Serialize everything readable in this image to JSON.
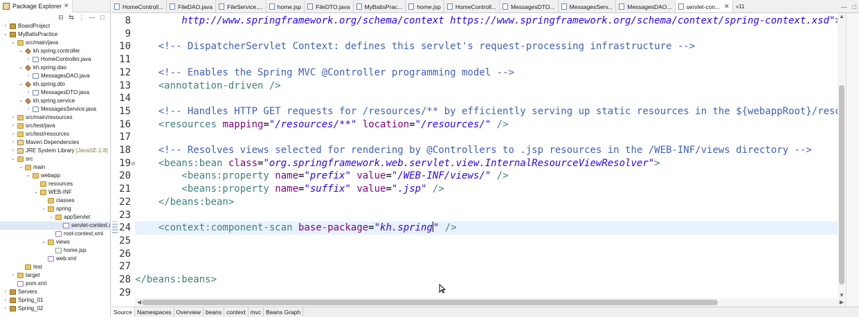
{
  "package_explorer": {
    "title": "Package Explorer",
    "tree": [
      {
        "label": "BoardProject",
        "depth": 0,
        "twisty": ">",
        "icon": "project"
      },
      {
        "label": "MyBatisPractice",
        "depth": 0,
        "twisty": "v",
        "icon": "project"
      },
      {
        "label": "src/main/java",
        "depth": 1,
        "twisty": "v",
        "icon": "folder"
      },
      {
        "label": "kh.spring.controller",
        "depth": 2,
        "twisty": "v",
        "icon": "pkg"
      },
      {
        "label": "HomeController.java",
        "depth": 3,
        "twisty": ">",
        "icon": "java"
      },
      {
        "label": "kh.spring.dao",
        "depth": 2,
        "twisty": "v",
        "icon": "pkg"
      },
      {
        "label": "MessagesDAO.java",
        "depth": 3,
        "twisty": ">",
        "icon": "java"
      },
      {
        "label": "kh.spring.dto",
        "depth": 2,
        "twisty": "v",
        "icon": "pkg"
      },
      {
        "label": "MessagesDTO.java",
        "depth": 3,
        "twisty": ">",
        "icon": "java"
      },
      {
        "label": "kh.spring.service",
        "depth": 2,
        "twisty": "v",
        "icon": "pkg"
      },
      {
        "label": "MessagesService.java",
        "depth": 3,
        "twisty": ">",
        "icon": "java"
      },
      {
        "label": "src/main/resources",
        "depth": 1,
        "twisty": ">",
        "icon": "folder"
      },
      {
        "label": "src/test/java",
        "depth": 1,
        "twisty": ">",
        "icon": "folder"
      },
      {
        "label": "src/test/resources",
        "depth": 1,
        "twisty": ">",
        "icon": "folder"
      },
      {
        "label": "Maven Dependencies",
        "depth": 1,
        "twisty": ">",
        "icon": "lib"
      },
      {
        "label": "JRE System Library",
        "extra": "[JavaSE-1.8]",
        "depth": 1,
        "twisty": ">",
        "icon": "lib"
      },
      {
        "label": "src",
        "depth": 1,
        "twisty": "v",
        "icon": "folder"
      },
      {
        "label": "main",
        "depth": 2,
        "twisty": "v",
        "icon": "folder"
      },
      {
        "label": "webapp",
        "depth": 3,
        "twisty": "v",
        "icon": "folder"
      },
      {
        "label": "resources",
        "depth": 4,
        "twisty": "",
        "icon": "folder"
      },
      {
        "label": "WEB-INF",
        "depth": 4,
        "twisty": "v",
        "icon": "folder"
      },
      {
        "label": "classes",
        "depth": 5,
        "twisty": "",
        "icon": "folder"
      },
      {
        "label": "spring",
        "depth": 5,
        "twisty": "v",
        "icon": "folder"
      },
      {
        "label": "appServlet",
        "depth": 6,
        "twisty": "v",
        "icon": "folder"
      },
      {
        "label": "servlet-context.xml",
        "depth": 7,
        "twisty": "",
        "icon": "xml",
        "selected": true
      },
      {
        "label": "root-context.xml",
        "depth": 6,
        "twisty": "",
        "icon": "xml"
      },
      {
        "label": "views",
        "depth": 5,
        "twisty": "v",
        "icon": "folder"
      },
      {
        "label": "home.jsp",
        "depth": 6,
        "twisty": "",
        "icon": "jsp"
      },
      {
        "label": "web.xml",
        "depth": 5,
        "twisty": "",
        "icon": "xml"
      },
      {
        "label": "test",
        "depth": 2,
        "twisty": "",
        "icon": "folder"
      },
      {
        "label": "target",
        "depth": 1,
        "twisty": ">",
        "icon": "folder"
      },
      {
        "label": "pom.xml",
        "depth": 1,
        "twisty": "",
        "icon": "xml"
      },
      {
        "label": "Servers",
        "depth": 0,
        "twisty": ">",
        "icon": "project"
      },
      {
        "label": "Spring_01",
        "depth": 0,
        "twisty": ">",
        "icon": "project"
      },
      {
        "label": "Spring_02",
        "depth": 0,
        "twisty": ">",
        "icon": "project"
      }
    ]
  },
  "editor_tabs": [
    {
      "label": "HomeControll..."
    },
    {
      "label": "FileDAO.java"
    },
    {
      "label": "FileService...."
    },
    {
      "label": "home.jsp"
    },
    {
      "label": "FileDTO.java"
    },
    {
      "label": "MyBatisPrac..."
    },
    {
      "label": "home.jsp"
    },
    {
      "label": "HomeControll..."
    },
    {
      "label": "MessagesDTO..."
    },
    {
      "label": "MessagesServ..."
    },
    {
      "label": "MessagesDAO..."
    },
    {
      "label": "servlet-con...",
      "active": true
    }
  ],
  "editor_overflow": "»11",
  "code_lines": [
    {
      "n": "8",
      "tokens": [
        {
          "c": "vl",
          "t": "        http://www.springframework.org/schema/context https://www.springframework.org/schema/context/spring-context.xsd\">"
        }
      ]
    },
    {
      "n": "9",
      "tokens": []
    },
    {
      "n": "10",
      "tokens": [
        {
          "c": "cm",
          "t": "    <!-- DispatcherServlet Context: defines this servlet's request-processing infrastructure -->"
        }
      ]
    },
    {
      "n": "11",
      "tokens": []
    },
    {
      "n": "12",
      "tokens": [
        {
          "c": "cm",
          "t": "    <!-- Enables the Spring MVC @Controller programming model -->"
        }
      ]
    },
    {
      "n": "13",
      "tokens": [
        {
          "c": "tg",
          "t": "    <annotation-driven />"
        }
      ]
    },
    {
      "n": "14",
      "tokens": []
    },
    {
      "n": "15",
      "tokens": [
        {
          "c": "cm",
          "t": "    <!-- Handles HTTP GET requests for /resources/** by efficiently serving up static resources in the ${webappRoot}/resources directory -->"
        }
      ]
    },
    {
      "n": "16",
      "tokens": [
        {
          "c": "tg",
          "t": "    <resources "
        },
        {
          "c": "at",
          "t": "mapping"
        },
        {
          "c": "pl",
          "t": "="
        },
        {
          "c": "vl",
          "t": "\"/resources/**\""
        },
        {
          "c": "pl",
          "t": " "
        },
        {
          "c": "at",
          "t": "location"
        },
        {
          "c": "pl",
          "t": "="
        },
        {
          "c": "vl",
          "t": "\"/resources/\""
        },
        {
          "c": "tg",
          "t": " />"
        }
      ]
    },
    {
      "n": "17",
      "tokens": []
    },
    {
      "n": "18",
      "tokens": [
        {
          "c": "cm",
          "t": "    <!-- Resolves views selected for rendering by @Controllers to .jsp resources in the /WEB-INF/views directory -->"
        }
      ]
    },
    {
      "n": "19",
      "fold": "⊖",
      "tokens": [
        {
          "c": "tg",
          "t": "    <beans:bean "
        },
        {
          "c": "at",
          "t": "class"
        },
        {
          "c": "pl",
          "t": "="
        },
        {
          "c": "vl",
          "t": "\"org.springframework.web.servlet.view.InternalResourceViewResolver\""
        },
        {
          "c": "tg",
          "t": ">"
        }
      ]
    },
    {
      "n": "20",
      "tokens": [
        {
          "c": "tg",
          "t": "        <beans:property "
        },
        {
          "c": "at",
          "t": "name"
        },
        {
          "c": "pl",
          "t": "="
        },
        {
          "c": "vl",
          "t": "\"prefix\""
        },
        {
          "c": "pl",
          "t": " "
        },
        {
          "c": "at",
          "t": "value"
        },
        {
          "c": "pl",
          "t": "="
        },
        {
          "c": "vl",
          "t": "\"/WEB-INF/views/\""
        },
        {
          "c": "tg",
          "t": " />"
        }
      ]
    },
    {
      "n": "21",
      "tokens": [
        {
          "c": "tg",
          "t": "        <beans:property "
        },
        {
          "c": "at",
          "t": "name"
        },
        {
          "c": "pl",
          "t": "="
        },
        {
          "c": "vl",
          "t": "\"suffix\""
        },
        {
          "c": "pl",
          "t": " "
        },
        {
          "c": "at",
          "t": "value"
        },
        {
          "c": "pl",
          "t": "="
        },
        {
          "c": "vl",
          "t": "\".jsp\""
        },
        {
          "c": "tg",
          "t": " />"
        }
      ]
    },
    {
      "n": "22",
      "tokens": [
        {
          "c": "tg",
          "t": "    </beans:bean>"
        }
      ]
    },
    {
      "n": "23",
      "tokens": []
    },
    {
      "n": "24",
      "current": true,
      "tokens": [
        {
          "c": "tg",
          "t": "    <context:component-scan "
        },
        {
          "c": "at",
          "t": "base-package"
        },
        {
          "c": "pl",
          "t": "="
        },
        {
          "c": "vl",
          "t": "\"kh.spring"
        },
        {
          "c": "caret",
          "t": ""
        },
        {
          "c": "vl",
          "t": "\""
        },
        {
          "c": "tg",
          "t": " />"
        }
      ]
    },
    {
      "n": "25",
      "tokens": []
    },
    {
      "n": "26",
      "tokens": []
    },
    {
      "n": "27",
      "tokens": []
    },
    {
      "n": "28",
      "tokens": [
        {
          "c": "tg",
          "t": "</beans:beans>"
        }
      ]
    },
    {
      "n": "29",
      "tokens": []
    }
  ],
  "bottom_tabs": [
    {
      "label": "Source",
      "active": true
    },
    {
      "label": "Namespaces"
    },
    {
      "label": "Overview"
    },
    {
      "label": "beans"
    },
    {
      "label": "context"
    },
    {
      "label": "mvc"
    },
    {
      "label": "Beans Graph"
    }
  ],
  "colors": {
    "comment": "#3f5fbf",
    "tag": "#3f7f7f",
    "attribute": "#7f007f",
    "value": "#2a00ff",
    "current_line": "#e8f2fe"
  }
}
